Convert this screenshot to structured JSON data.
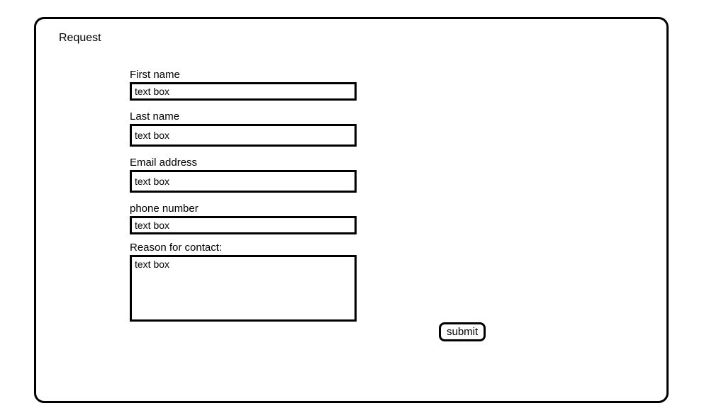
{
  "title": "Request",
  "fields": {
    "first_name": {
      "label": "First name",
      "value": "text box"
    },
    "last_name": {
      "label": "Last name",
      "value": "text box"
    },
    "email": {
      "label": "Email address",
      "value": "text box"
    },
    "phone": {
      "label": "phone number",
      "value": "text box"
    },
    "reason": {
      "label": "Reason for contact:",
      "value": "text box"
    }
  },
  "submit_label": "submit"
}
